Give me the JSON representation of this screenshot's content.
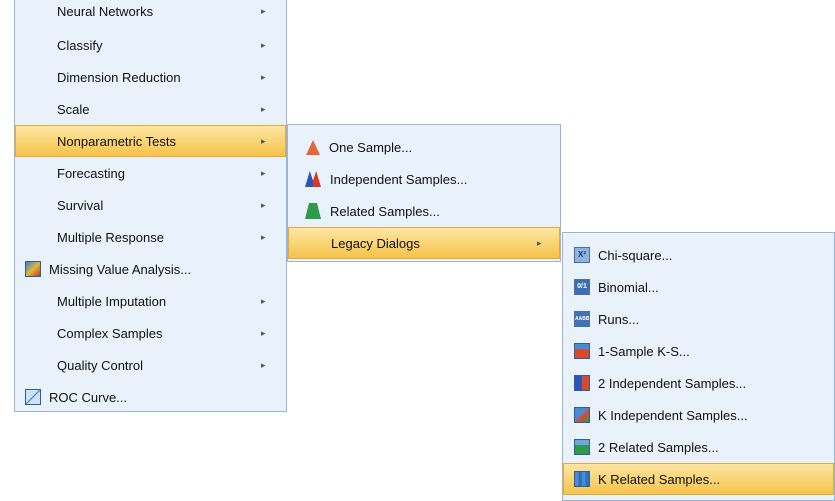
{
  "menu1": {
    "items": [
      {
        "label": "Neural Networks",
        "arrow": "▸"
      },
      {
        "label": "Classify",
        "arrow": "▸"
      },
      {
        "label": "Dimension Reduction",
        "arrow": "▸"
      },
      {
        "label": "Scale",
        "arrow": "▸"
      },
      {
        "label": "Nonparametric Tests",
        "arrow": "▸"
      },
      {
        "label": "Forecasting",
        "arrow": "▸"
      },
      {
        "label": "Survival",
        "arrow": "▸"
      },
      {
        "label": "Multiple Response",
        "arrow": "▸"
      },
      {
        "label": "Missing Value Analysis...",
        "arrow": ""
      },
      {
        "label": "Multiple Imputation",
        "arrow": "▸"
      },
      {
        "label": "Complex Samples",
        "arrow": "▸"
      },
      {
        "label": "Quality Control",
        "arrow": "▸"
      },
      {
        "label": "ROC Curve...",
        "arrow": ""
      }
    ]
  },
  "menu2": {
    "items": [
      {
        "label": "One Sample..."
      },
      {
        "label": "Independent Samples..."
      },
      {
        "label": "Related Samples..."
      },
      {
        "label": "Legacy Dialogs",
        "arrow": "▸"
      }
    ]
  },
  "menu3": {
    "items": [
      {
        "label": "Chi-square...",
        "icon_text": "X²"
      },
      {
        "label": "Binomial...",
        "icon_text": "0/1"
      },
      {
        "label": "Runs...",
        "icon_text": "AABB"
      },
      {
        "label": "1-Sample K-S..."
      },
      {
        "label": "2 Independent Samples..."
      },
      {
        "label": "K Independent Samples..."
      },
      {
        "label": "2 Related Samples..."
      },
      {
        "label": "K Related Samples..."
      }
    ]
  },
  "colors": {
    "menu_bg": "#e9f1fb",
    "highlight": "#f7c34a",
    "border": "#9db3cf"
  }
}
